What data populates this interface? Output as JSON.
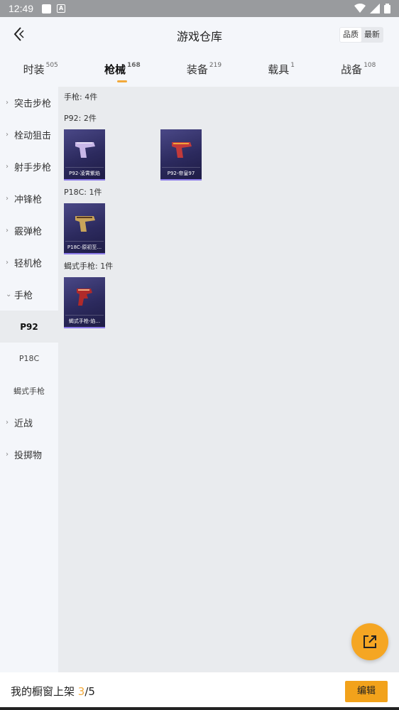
{
  "status": {
    "time": "12:49"
  },
  "header": {
    "title": "游戏仓库",
    "sort": [
      "品质",
      "最新"
    ]
  },
  "tabs": [
    {
      "label": "时装",
      "count": "505"
    },
    {
      "label": "枪械",
      "count": "168"
    },
    {
      "label": "装备",
      "count": "219"
    },
    {
      "label": "载具",
      "count": "1"
    },
    {
      "label": "战备",
      "count": "108"
    }
  ],
  "sidebar": {
    "items": [
      "突击步枪",
      "栓动狙击",
      "射手步枪",
      "冲锋枪",
      "霰弹枪",
      "轻机枪",
      "手枪"
    ],
    "sub": [
      "P92",
      "P18C",
      "蝎式手枪"
    ],
    "after": [
      "近战",
      "投掷物"
    ]
  },
  "content": {
    "total": "手枪: 4件",
    "groups": [
      {
        "label": "P92: 2件",
        "cards": [
          "P92-凌霄紫焰",
          "P92-帝皇97"
        ]
      },
      {
        "label": "P18C: 1件",
        "cards": [
          "P18C-原初至..."
        ]
      },
      {
        "label": "蝎式手枪: 1件",
        "cards": [
          "蝎式手枪-焰..."
        ]
      }
    ]
  },
  "bottom": {
    "prefix": "我的橱窗上架 ",
    "current": "3",
    "suffix": "/5",
    "edit": "编辑"
  },
  "colors": {
    "accent": "#f2a21b",
    "card_bg": "#2c2a5e"
  }
}
